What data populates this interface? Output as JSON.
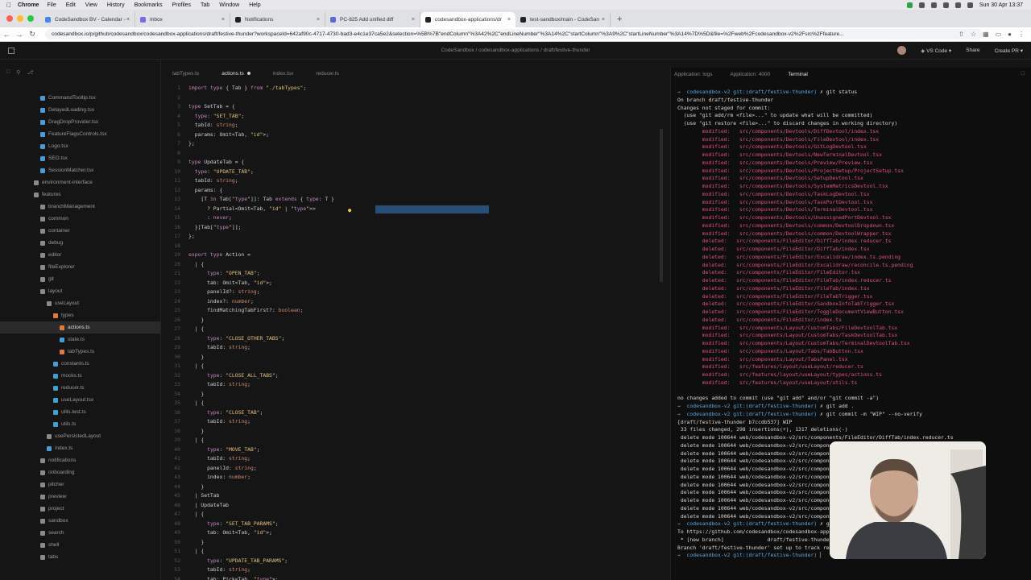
{
  "menubar": {
    "app": "Chrome",
    "items": [
      "File",
      "Edit",
      "View",
      "History",
      "Bookmarks",
      "Profiles",
      "Tab",
      "Window",
      "Help"
    ],
    "datetime": "Sun 30 Apr 13:37"
  },
  "tabs": [
    {
      "title": "CodeSandbox BV - Calendar - ",
      "color": "#4285f4"
    },
    {
      "title": "Inbox",
      "color": "#7b68ee"
    },
    {
      "title": "Notifications",
      "color": "#222"
    },
    {
      "title": "PC-825 Add unified diff",
      "color": "#5e6ad2"
    },
    {
      "title": "codesandbox-applications/dr",
      "color": "#222",
      "active": true
    },
    {
      "title": "test-sandbox/main - CodeSan",
      "color": "#222"
    }
  ],
  "address": {
    "url": "codesandbox.io/p/github/codesandbox/codesandbox-applications/draft/festive-thunder?workspaceId=642af90c-4717-4730-bad3-e4c1e37ca5e2&selection=%5B%7B\"endColumn\"%3A42%2C\"endLineNumber\"%3A14%2C\"startColumn\"%3A9%2C\"startLineNumber\"%3A14%7D%5D&file=%2Fweb%2Fcodesandbox-v2%2Fsrc%2Ffeature..."
  },
  "topbar": {
    "title": "CodeSandbox / codesandbox-applications / draft/festive-thunder",
    "editor": "VS Code",
    "share": "Share",
    "create_pr": "Create PR"
  },
  "sidebar": {
    "rows": [
      {
        "label": "CommandTooltip.tsx",
        "indent": 50,
        "color": "#3f9fd8"
      },
      {
        "label": "DelayedLoading.tsx",
        "indent": 50,
        "color": "#3f9fd8"
      },
      {
        "label": "DragDropProvider.tsx",
        "indent": 50,
        "color": "#3f9fd8"
      },
      {
        "label": "FeatureFlagsControls.tsx",
        "indent": 50,
        "color": "#3f9fd8"
      },
      {
        "label": "Logo.tsx",
        "indent": 50,
        "color": "#3f9fd8"
      },
      {
        "label": "SEO.tsx",
        "indent": 50,
        "color": "#3f9fd8"
      },
      {
        "label": "SessionMatcher.tsx",
        "indent": 50,
        "color": "#3f9fd8"
      },
      {
        "label": "environment-interface",
        "indent": 42,
        "color": "#8a8a8a"
      },
      {
        "label": "features",
        "indent": 42,
        "color": "#8a8a8a"
      },
      {
        "label": "branchManagement",
        "indent": 50,
        "color": "#8a8a8a"
      },
      {
        "label": "common",
        "indent": 50,
        "color": "#8a8a8a"
      },
      {
        "label": "container",
        "indent": 50,
        "color": "#8a8a8a"
      },
      {
        "label": "debug",
        "indent": 50,
        "color": "#8a8a8a"
      },
      {
        "label": "editor",
        "indent": 50,
        "color": "#8a8a8a"
      },
      {
        "label": "fileExplorer",
        "indent": 50,
        "color": "#8a8a8a"
      },
      {
        "label": "git",
        "indent": 50,
        "color": "#8a8a8a"
      },
      {
        "label": "layout",
        "indent": 50,
        "color": "#8a8a8a"
      },
      {
        "label": "useLayout",
        "indent": 58,
        "color": "#8a8a8a"
      },
      {
        "label": "types",
        "indent": 66,
        "color": "#e07a3a"
      },
      {
        "label": "actions.ts",
        "indent": 74,
        "color": "#e07a3a",
        "sel": true
      },
      {
        "label": "state.ts",
        "indent": 74,
        "color": "#3f9fd8"
      },
      {
        "label": "tabTypes.ts",
        "indent": 74,
        "color": "#e07a3a"
      },
      {
        "label": "constants.ts",
        "indent": 66,
        "color": "#3f9fd8"
      },
      {
        "label": "mocks.ts",
        "indent": 66,
        "color": "#3f9fd8"
      },
      {
        "label": "reducer.ts",
        "indent": 66,
        "color": "#3f9fd8"
      },
      {
        "label": "useLayout.tsx",
        "indent": 66,
        "color": "#3f9fd8"
      },
      {
        "label": "utils.test.ts",
        "indent": 66,
        "color": "#3f9fd8"
      },
      {
        "label": "utils.ts",
        "indent": 66,
        "color": "#3f9fd8"
      },
      {
        "label": "usePersistedLayout",
        "indent": 58,
        "color": "#8a8a8a"
      },
      {
        "label": "index.ts",
        "indent": 58,
        "color": "#3f9fd8"
      },
      {
        "label": "notifications",
        "indent": 50,
        "color": "#8a8a8a"
      },
      {
        "label": "onboarding",
        "indent": 50,
        "color": "#8a8a8a"
      },
      {
        "label": "pitcher",
        "indent": 50,
        "color": "#8a8a8a"
      },
      {
        "label": "preview",
        "indent": 50,
        "color": "#8a8a8a"
      },
      {
        "label": "project",
        "indent": 50,
        "color": "#8a8a8a"
      },
      {
        "label": "sandbox",
        "indent": 50,
        "color": "#8a8a8a"
      },
      {
        "label": "search",
        "indent": 50,
        "color": "#8a8a8a"
      },
      {
        "label": "shell",
        "indent": 50,
        "color": "#8a8a8a"
      },
      {
        "label": "tabs",
        "indent": 50,
        "color": "#8a8a8a"
      }
    ]
  },
  "editor_tabs": [
    {
      "label": "tabTypes.ts"
    },
    {
      "label": "actions.ts",
      "active": true,
      "modified": true
    },
    {
      "label": "index.tsx"
    },
    {
      "label": "reducer.ts"
    }
  ],
  "code": [
    "import type { Tab } from \"./tabTypes\";",
    "",
    "type SetTab = {",
    "  type: \"SET_TAB\";",
    "  tabId: string;",
    "  params: Omit<Tab, \"id\">;",
    "};",
    "",
    "type UpdateTab = {",
    "  type: \"UPDATE_TAB\";",
    "  tabId: string;",
    "  params: {",
    "    [T in Tab[\"type\"]]: Tab extends { type: T }",
    "      ? Partial<Omit<Tab, \"id\" | \"type\">>",
    "      : never;",
    "  }[Tab[\"type\"]];",
    "};",
    "",
    "export type Action =",
    "  | {",
    "      type: \"OPEN_TAB\";",
    "      tab: Omit<Tab, \"id\">;",
    "      panelId?: string;",
    "      index?: number;",
    "      findMatchingTabFirst?: boolean;",
    "    }",
    "  | {",
    "      type: \"CLOSE_OTHER_TABS\";",
    "      tabId: string;",
    "    }",
    "  | {",
    "      type: \"CLOSE_ALL_TABS\";",
    "      tabId: string;",
    "    }",
    "  | {",
    "      type: \"CLOSE_TAB\";",
    "      tabId: string;",
    "    }",
    "  | {",
    "      type: \"MOVE_TAB\";",
    "      tabId: string;",
    "      panelId: string;",
    "      index: number;",
    "    }",
    "  | SetTab",
    "  | UpdateTab",
    "  | {",
    "      type: \"SET_TAB_PARAMS\";",
    "      tab: Omit<Tab, \"id\">;",
    "    }",
    "  | {",
    "      type: \"UPDATE_TAB_PARAMS\";",
    "      tabId: string;",
    "      tab: Pick<Tab, \"type\">;"
  ],
  "right_tabs": [
    {
      "label": "Application: logs"
    },
    {
      "label": "Application: 4000"
    },
    {
      "label": "Terminal",
      "active": true
    }
  ],
  "terminal": {
    "prompt_user": "codesandbox-v2",
    "prompt_branch": "git:(draft/festive-thunder)",
    "cmd_status": "git status",
    "status_header": [
      "On branch draft/festive-thunder",
      "Changes not staged for commit:",
      "  (use \"git add/rm <file>...\" to update what will be committed)",
      "  (use \"git restore <file>...\" to discard changes in working directory)"
    ],
    "changes": [
      [
        "modified:",
        "src/components/Devtools/DiffDevtool/index.tsx"
      ],
      [
        "modified:",
        "src/components/Devtools/FileDevtool/index.tsx"
      ],
      [
        "modified:",
        "src/components/Devtools/GitLogDevtool.tsx"
      ],
      [
        "modified:",
        "src/components/Devtools/NewTerminalDevtool.tsx"
      ],
      [
        "modified:",
        "src/components/Devtools/Preview/Preview.tsx"
      ],
      [
        "modified:",
        "src/components/Devtools/ProjectSetup/ProjectSetup.tsx"
      ],
      [
        "modified:",
        "src/components/Devtools/SetupDevtool.tsx"
      ],
      [
        "modified:",
        "src/components/Devtools/SystemMetricsDevtool.tsx"
      ],
      [
        "modified:",
        "src/components/Devtools/TaskLogDevtool.tsx"
      ],
      [
        "modified:",
        "src/components/Devtools/TaskPortDevtool.tsx"
      ],
      [
        "modified:",
        "src/components/Devtools/TerminalDevtool.tsx"
      ],
      [
        "modified:",
        "src/components/Devtools/UnassignedPortDevtool.tsx"
      ],
      [
        "modified:",
        "src/components/Devtools/common/DevtoolDropdown.tsx"
      ],
      [
        "modified:",
        "src/components/Devtools/common/DevtoolWrapper.tsx"
      ],
      [
        "deleted:",
        "src/components/FileEditor/DiffTab/index.reducer.ts"
      ],
      [
        "deleted:",
        "src/components/FileEditor/DiffTab/index.tsx"
      ],
      [
        "deleted:",
        "src/components/FileEditor/Excalidraw/index.ts.pending"
      ],
      [
        "deleted:",
        "src/components/FileEditor/Excalidraw/reconcile.ts.pending"
      ],
      [
        "deleted:",
        "src/components/FileEditor/FileEditor.tsx"
      ],
      [
        "deleted:",
        "src/components/FileEditor/FileTab/index.reducer.ts"
      ],
      [
        "deleted:",
        "src/components/FileEditor/FileTab/index.tsx"
      ],
      [
        "deleted:",
        "src/components/FileEditor/FileTabTrigger.tsx"
      ],
      [
        "deleted:",
        "src/components/FileEditor/SandboxInfoTabTrigger.tsx"
      ],
      [
        "deleted:",
        "src/components/FileEditor/ToggleDocumentViewButton.tsx"
      ],
      [
        "deleted:",
        "src/components/FileEditor/index.ts"
      ],
      [
        "modified:",
        "src/components/Layout/CustomTabs/FileDevtoolTab.tsx"
      ],
      [
        "modified:",
        "src/components/Layout/CustomTabs/TaskDevtoolTab.tsx"
      ],
      [
        "modified:",
        "src/components/Layout/CustomTabs/TerminalDevtoolTab.tsx"
      ],
      [
        "modified:",
        "src/components/Layout/Tabs/TabButton.tsx"
      ],
      [
        "modified:",
        "src/components/Layout/TabsPanel.tsx"
      ],
      [
        "modified:",
        "src/features/layout/useLayout/reducer.ts"
      ],
      [
        "modified:",
        "src/features/layout/useLayout/types/actions.ts"
      ],
      [
        "modified:",
        "src/features/layout/useLayout/utils.ts"
      ]
    ],
    "no_changes": "no changes added to commit (use \"git add\" and/or \"git commit -a\")",
    "cmd_add": "git add .",
    "cmd_commit": "git commit -m \"WIP\" --no-verify",
    "commit_line": "[draft/festive-thunder b7ccdb537] WIP",
    "summary": " 33 files changed, 298 insertions(+), 1317 deletions(-)",
    "delete_lines": [
      " delete mode 100644 web/codesandbox-v2/src/components/FileEditor/DiffTab/index.reducer.ts",
      " delete mode 100644 web/codesandbox-v2/src/componen",
      " delete mode 100644 web/codesandbox-v2/src/componen",
      " delete mode 100644 web/codesandbox-v2/src/componen",
      " delete mode 100644 web/codesandbox-v2/src/componen",
      " delete mode 100644 web/codesandbox-v2/src/componen",
      " delete mode 100644 web/codesandbox-v2/src/componen",
      " delete mode 100644 web/codesandbox-v2/src/componen",
      " delete mode 100644 web/codesandbox-v2/src/componen",
      " delete mode 100644 web/codesandbox-v2/src/componen",
      " delete mode 100644 web/codesandbox-v2/src/componen"
    ],
    "cmd_push": "git p",
    "push_lines": [
      "To https://github.com/codesandbox/codesandbox-appli",
      " * [new branch]              draft/festive-thunder -> d",
      "Branch 'draft/festive-thunder' set up to track remo"
    ]
  }
}
